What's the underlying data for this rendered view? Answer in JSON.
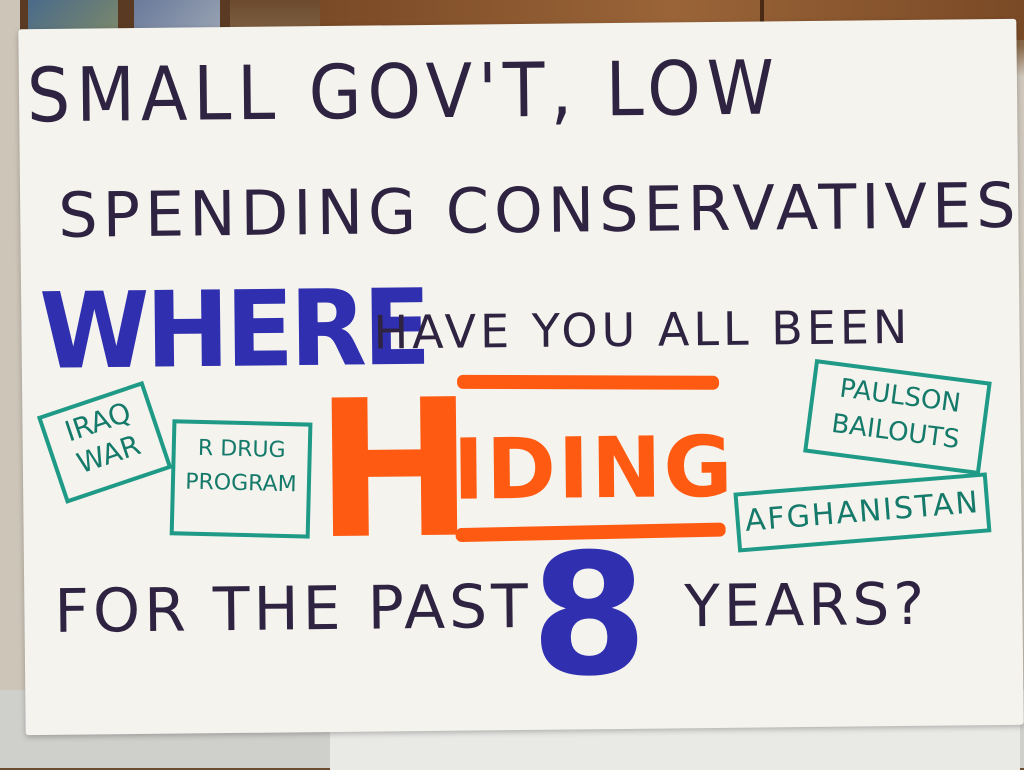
{
  "sign": {
    "line1": "SMALL GOV'T, LOW",
    "line2": "SPENDING CONSERVATIVES",
    "where": "WHERE",
    "have_you": "HAVE YOU ALL BEEN",
    "hiding_first": "H",
    "hiding_rest": "IDING",
    "for_the_past": "FOR THE PAST",
    "eight": "8",
    "years": "YEARS?"
  },
  "boxes": {
    "iraq": [
      "IRAQ",
      "WAR"
    ],
    "rx": [
      "R DRUG",
      "PROGRAM"
    ],
    "paulson": [
      "PAULSON",
      "BAILOUTS"
    ],
    "afghanistan": "AFGHANISTAN"
  },
  "colors": {
    "ink_dark": "#2e2340",
    "ink_blue": "#2f2fb0",
    "ink_orange": "#ff5a12",
    "ink_teal": "#1f9a86",
    "board": "#f4f3ee"
  }
}
